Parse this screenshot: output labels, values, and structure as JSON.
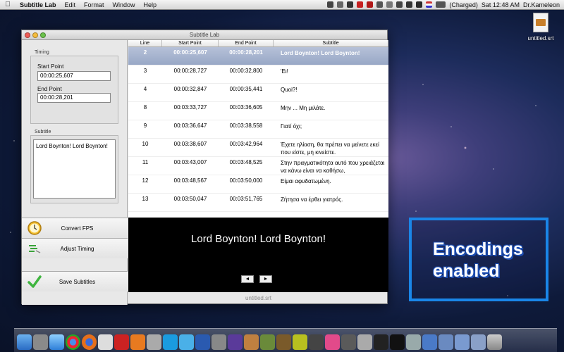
{
  "menubar": {
    "app_name": "Subtitle Lab",
    "menus": [
      "Edit",
      "Format",
      "Window",
      "Help"
    ],
    "battery": "(Charged)",
    "clock": "Sat 12:48 AM",
    "user": "Dr.Kameleon"
  },
  "desktop": {
    "file_label": "untitled.srt"
  },
  "window": {
    "title": "Subtitle Lab",
    "status_filename": "untitled.srt"
  },
  "timing": {
    "group_label": "Timing",
    "start_label": "Start Point",
    "start_value": "00:00:25,607",
    "end_label": "End Point",
    "end_value": "00:00:28,201"
  },
  "subtitle_box": {
    "group_label": "Subtitle",
    "text": "Lord Boynton! Lord Boynton!"
  },
  "buttons": {
    "convert_fps": "Convert FPS",
    "adjust_timing": "Adjust Timing",
    "save_subtitles": "Save Subtitles"
  },
  "table": {
    "headers": [
      "Line",
      "Start Point",
      "End Point",
      "Subtitle"
    ],
    "rows": [
      {
        "line": "2",
        "start": "00:00:25,607",
        "end": "00:00:28,201",
        "text": "Lord Boynton! Lord Boynton!",
        "selected": true
      },
      {
        "line": "3",
        "start": "00:00:28,727",
        "end": "00:00:32,800",
        "text": "'Ει!"
      },
      {
        "line": "4",
        "start": "00:00:32,847",
        "end": "00:00:35,441",
        "text": "Quoi?!"
      },
      {
        "line": "8",
        "start": "00:03:33,727",
        "end": "00:03:36,605",
        "text": "Μην ... Μη μιλάτε."
      },
      {
        "line": "9",
        "start": "00:03:36,647",
        "end": "00:03:38,558",
        "text": "Γιατί όχι;"
      },
      {
        "line": "10",
        "start": "00:03:38,607",
        "end": "00:03:42,964",
        "text": "Έχετε ηλίαση, θα πρέπει να μείνετε εκεί που είστε, μη κινείστε."
      },
      {
        "line": "11",
        "start": "00:03:43,007",
        "end": "00:03:48,525",
        "text": "Στην πραγματικότητα αυτό που χρειάζεται να κάνω είναι να καθήσω,"
      },
      {
        "line": "12",
        "start": "00:03:48,567",
        "end": "00:03:50,000",
        "text": "Είμαι αφυδατωμένη."
      },
      {
        "line": "13",
        "start": "00:03:50,047",
        "end": "00:03:51,765",
        "text": "Ζήτησα να έρθει γιατρός."
      }
    ]
  },
  "preview": {
    "text": "Lord Boynton! Lord Boynton!",
    "prev": "◄",
    "next": "►"
  },
  "promo_badge": {
    "line1": "Encodings",
    "line2": "enabled"
  },
  "colors": {
    "accent": "#1a86e8",
    "selection": "#98a8c6"
  }
}
